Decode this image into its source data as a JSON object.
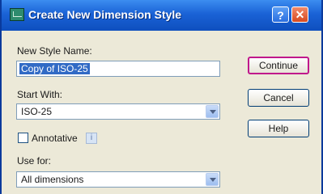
{
  "dialog": {
    "title": "Create New Dimension Style",
    "new_style_name_label": "New Style Name:",
    "new_style_name_value": "Copy of ISO-25",
    "start_with_label": "Start With:",
    "start_with_value": "ISO-25",
    "annotative_label": "Annotative",
    "annotative_checked": false,
    "use_for_label": "Use for:",
    "use_for_value": "All dimensions",
    "help_glyph": "?",
    "close_glyph": "✕",
    "info_glyph": "i"
  },
  "buttons": {
    "continue_label": "Continue",
    "cancel_label": "Cancel",
    "help_label": "Help"
  },
  "colors": {
    "title_bar": "#1A62D6",
    "default_button_highlight": "#C0188C",
    "selection": "#316AC5"
  }
}
